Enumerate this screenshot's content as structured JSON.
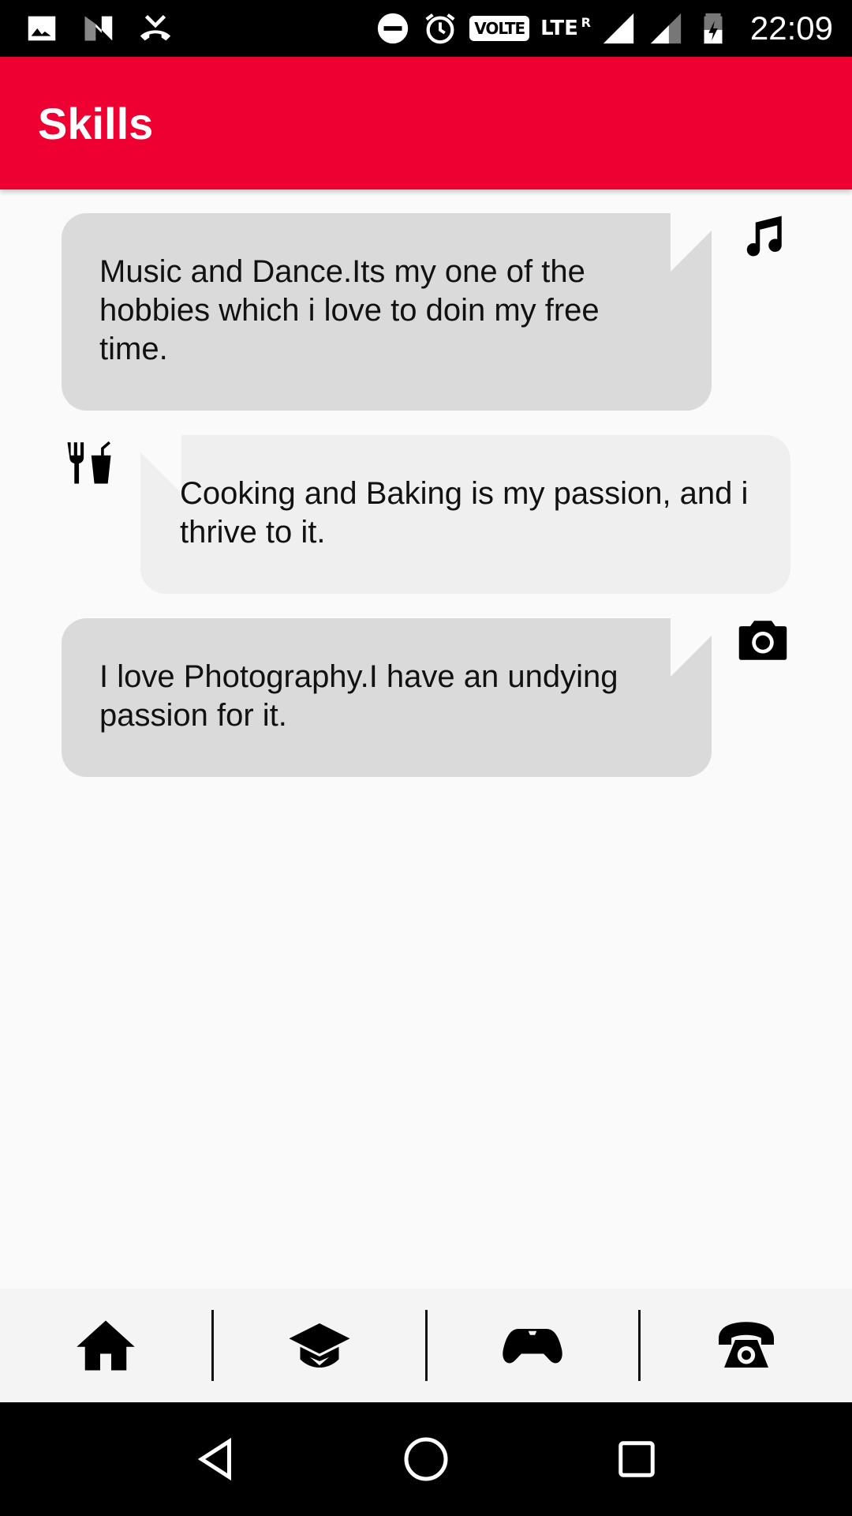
{
  "status_bar": {
    "time": "22:09",
    "volte_label": "VOLTE",
    "network_label": "LTE",
    "roaming_label": "R",
    "icons": [
      "image-icon",
      "n-icon",
      "missed-call-icon",
      "do-not-disturb-icon",
      "alarm-icon",
      "signal-icon",
      "signal-icon",
      "battery-icon"
    ]
  },
  "app_bar": {
    "title": "Skills"
  },
  "skills": [
    {
      "text": "Music and Dance.Its my one of the hobbies which i love to doin my free time.",
      "icon": "music-note-icon"
    },
    {
      "text": "Cooking and Baking is my passion, and i thrive to it.",
      "icon": "fork-cup-icon"
    },
    {
      "text": "I love Photography.I have an undying passion for it.",
      "icon": "camera-icon"
    }
  ],
  "bottom_nav": {
    "items": [
      {
        "icon": "home-icon"
      },
      {
        "icon": "graduation-cap-icon"
      },
      {
        "icon": "gamepad-icon"
      },
      {
        "icon": "telephone-icon"
      }
    ]
  },
  "system_nav": {
    "items": [
      {
        "icon": "back-icon"
      },
      {
        "icon": "home-circle-icon"
      },
      {
        "icon": "recents-icon"
      }
    ]
  },
  "colors": {
    "app_bar": "#ee0033",
    "card_dark": "#dadada",
    "card_light": "#efefef",
    "background": "#fafafa"
  }
}
